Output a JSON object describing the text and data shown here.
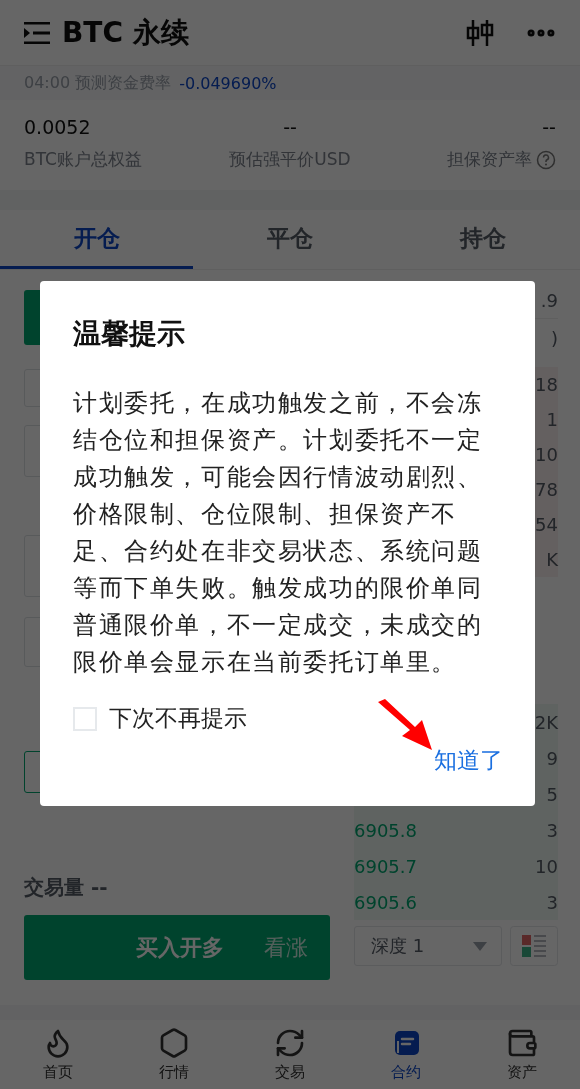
{
  "header": {
    "title": "BTC 永续"
  },
  "funding": {
    "label": "04:00 预测资金费率",
    "value": "-0.049690%"
  },
  "stats": [
    {
      "value": "0.0052",
      "label": "BTC账户总权益",
      "help": false
    },
    {
      "value": "--",
      "label": "预估强平价USD",
      "help": false
    },
    {
      "value": "--",
      "label": "担保资产率",
      "help": true
    }
  ],
  "tabs": [
    {
      "label": "开仓",
      "selected": true
    },
    {
      "label": "平仓",
      "selected": false
    },
    {
      "label": "持仓",
      "selected": false
    }
  ],
  "order_book": {
    "header": [
      ".9",
      ")"
    ],
    "asks": [
      "18",
      "1",
      "10",
      "78",
      "54",
      "K"
    ],
    "bids": [
      {
        "amount": "2K"
      },
      {
        "amount": "9"
      },
      {
        "amount": "5"
      },
      {
        "price": "6905.8",
        "amount": "3"
      },
      {
        "price": "6905.7",
        "amount": "10"
      },
      {
        "price": "6905.6",
        "amount": "3"
      }
    ],
    "depth_select": {
      "value": "深度 1"
    }
  },
  "volume": {
    "label": "交易量",
    "value": "--"
  },
  "buy_button": {
    "label": "买入开多",
    "hint": "看涨"
  },
  "dialog": {
    "title": "温馨提示",
    "message": "计划委托，在成功触发之前，不会冻结仓位和担保资产。计划委托不一定成功触发，可能会因行情波动剧烈、价格限制、仓位限制、担保资产不足、合约处在非交易状态、系统问题等而下单失败。触发成功的限价单同普通限价单，不一定成交，未成交的限价单会显示在当前委托订单里。",
    "checkbox": {
      "label": "下次不再提示",
      "checked": false
    },
    "confirm": "知道了"
  },
  "nav": [
    {
      "label": "首页",
      "selected": false
    },
    {
      "label": "行情",
      "selected": false
    },
    {
      "label": "交易",
      "selected": false
    },
    {
      "label": "合约",
      "selected": true
    },
    {
      "label": "资产",
      "selected": false
    }
  ]
}
